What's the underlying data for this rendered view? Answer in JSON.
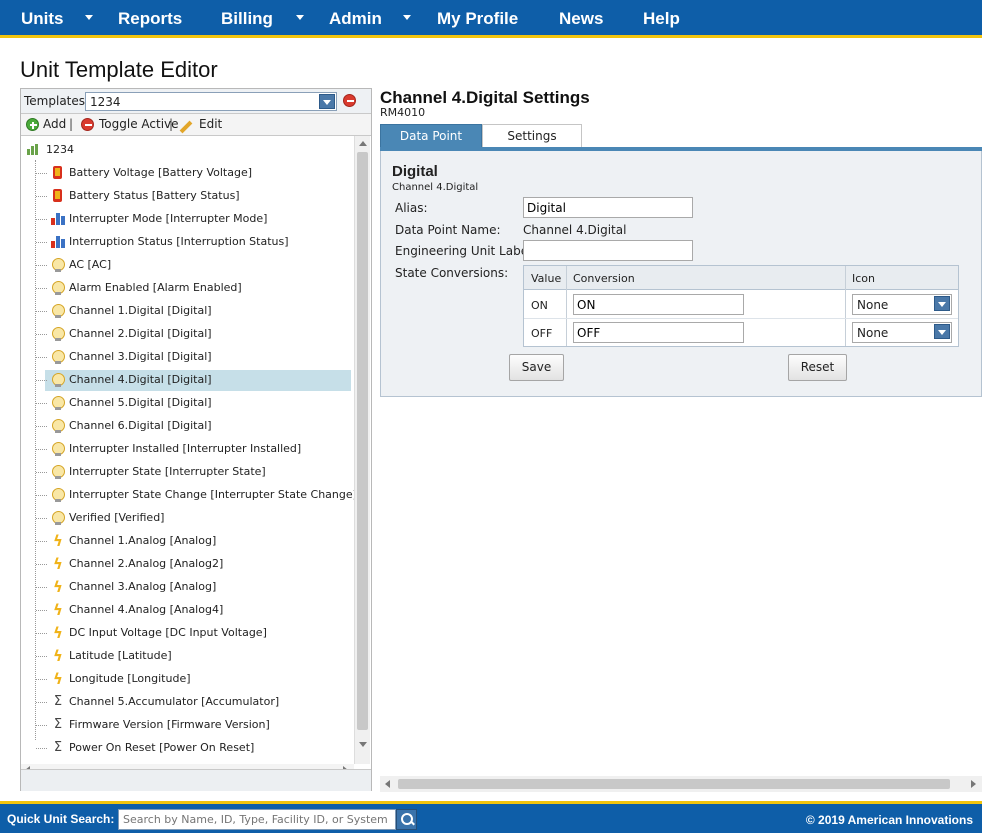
{
  "nav": {
    "units": "Units",
    "reports": "Reports",
    "billing": "Billing",
    "admin": "Admin",
    "my_profile": "My Profile",
    "news": "News",
    "help": "Help"
  },
  "page_title": "Unit Template Editor",
  "templates": {
    "label": "Templates",
    "selected": "1234"
  },
  "toolbar": {
    "add": "Add",
    "toggle_active": "Toggle Active",
    "edit": "Edit",
    "separator": "|"
  },
  "tree": {
    "root": "1234",
    "items": [
      {
        "label": "Battery Voltage [Battery Voltage]",
        "icon": "battery-icon"
      },
      {
        "label": "Battery Status [Battery Status]",
        "icon": "battery-icon"
      },
      {
        "label": "Interrupter Mode [Interrupter Mode]",
        "icon": "bar-chart-icon"
      },
      {
        "label": "Interruption Status [Interruption Status]",
        "icon": "bar-chart-icon"
      },
      {
        "label": "AC [AC]",
        "icon": "lightbulb-icon"
      },
      {
        "label": "Alarm Enabled [Alarm Enabled]",
        "icon": "lightbulb-icon"
      },
      {
        "label": "Channel 1.Digital [Digital]",
        "icon": "lightbulb-icon"
      },
      {
        "label": "Channel 2.Digital [Digital]",
        "icon": "lightbulb-icon"
      },
      {
        "label": "Channel 3.Digital [Digital]",
        "icon": "lightbulb-icon"
      },
      {
        "label": "Channel 4.Digital [Digital]",
        "icon": "lightbulb-icon",
        "selected": true
      },
      {
        "label": "Channel 5.Digital [Digital]",
        "icon": "lightbulb-icon"
      },
      {
        "label": "Channel 6.Digital [Digital]",
        "icon": "lightbulb-icon"
      },
      {
        "label": "Interrupter Installed [Interrupter Installed]",
        "icon": "lightbulb-icon"
      },
      {
        "label": "Interrupter State [Interrupter State]",
        "icon": "lightbulb-icon"
      },
      {
        "label": "Interrupter State Change [Interrupter State Change]",
        "icon": "lightbulb-icon"
      },
      {
        "label": "Verified [Verified]",
        "icon": "lightbulb-icon"
      },
      {
        "label": "Channel 1.Analog [Analog]",
        "icon": "lightning-icon"
      },
      {
        "label": "Channel 2.Analog [Analog2]",
        "icon": "lightning-icon"
      },
      {
        "label": "Channel 3.Analog [Analog]",
        "icon": "lightning-icon"
      },
      {
        "label": "Channel 4.Analog [Analog4]",
        "icon": "lightning-icon"
      },
      {
        "label": "DC Input Voltage [DC Input Voltage]",
        "icon": "lightning-icon"
      },
      {
        "label": "Latitude [Latitude]",
        "icon": "lightning-icon"
      },
      {
        "label": "Longitude [Longitude]",
        "icon": "lightning-icon"
      },
      {
        "label": "Channel 5.Accumulator [Accumulator]",
        "icon": "sigma-icon"
      },
      {
        "label": "Firmware Version [Firmware Version]",
        "icon": "sigma-icon"
      },
      {
        "label": "Power On Reset [Power On Reset]",
        "icon": "sigma-icon"
      }
    ]
  },
  "settings": {
    "title": "Channel 4.Digital Settings",
    "model": "RM4010",
    "tabs": [
      "Data Point",
      "Settings"
    ],
    "active_tab": "Data Point"
  },
  "data_point": {
    "heading": "Digital",
    "subheading": "Channel 4.Digital",
    "alias_label": "Alias:",
    "alias_value": "Digital",
    "name_label": "Data Point Name:",
    "name_value": "Channel 4.Digital",
    "eng_unit_label": "Engineering Unit Label:",
    "eng_unit_value": "",
    "state_conv_label": "State Conversions:",
    "table_headers": [
      "Value",
      "Conversion",
      "Icon"
    ],
    "rows": [
      {
        "value": "ON",
        "conversion": "ON",
        "icon": "None"
      },
      {
        "value": "OFF",
        "conversion": "OFF",
        "icon": "None"
      }
    ],
    "save": "Save",
    "reset": "Reset"
  },
  "footer": {
    "quick_search_label": "Quick Unit Search:",
    "quick_search_placeholder": "Search by Name, ID, Type, Facility ID, or System Serial",
    "copyright": "© 2019 American Innovations"
  },
  "colors": {
    "nav_blue": "#0e5ea8",
    "accent_yellow": "#f2c40d",
    "tab_blue": "#4a87b5",
    "selection": "#c6dfe8"
  }
}
